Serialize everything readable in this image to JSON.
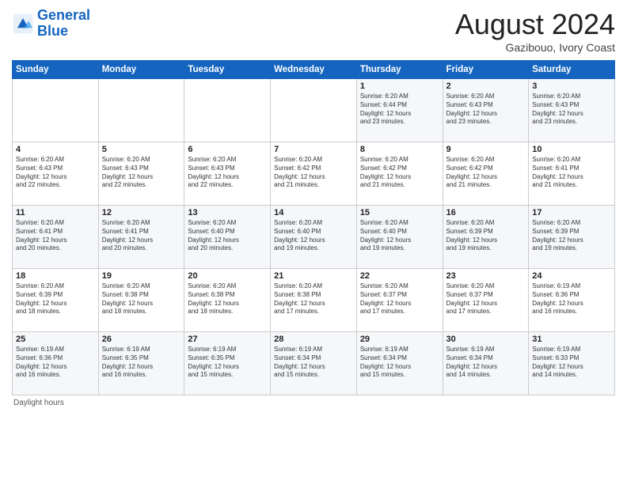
{
  "logo": {
    "line1": "General",
    "line2": "Blue"
  },
  "header": {
    "month_year": "August 2024",
    "location": "Gazibouo, Ivory Coast"
  },
  "days_of_week": [
    "Sunday",
    "Monday",
    "Tuesday",
    "Wednesday",
    "Thursday",
    "Friday",
    "Saturday"
  ],
  "weeks": [
    [
      {
        "day": "",
        "info": ""
      },
      {
        "day": "",
        "info": ""
      },
      {
        "day": "",
        "info": ""
      },
      {
        "day": "",
        "info": ""
      },
      {
        "day": "1",
        "info": "Sunrise: 6:20 AM\nSunset: 6:44 PM\nDaylight: 12 hours\nand 23 minutes."
      },
      {
        "day": "2",
        "info": "Sunrise: 6:20 AM\nSunset: 6:43 PM\nDaylight: 12 hours\nand 23 minutes."
      },
      {
        "day": "3",
        "info": "Sunrise: 6:20 AM\nSunset: 6:43 PM\nDaylight: 12 hours\nand 23 minutes."
      }
    ],
    [
      {
        "day": "4",
        "info": "Sunrise: 6:20 AM\nSunset: 6:43 PM\nDaylight: 12 hours\nand 22 minutes."
      },
      {
        "day": "5",
        "info": "Sunrise: 6:20 AM\nSunset: 6:43 PM\nDaylight: 12 hours\nand 22 minutes."
      },
      {
        "day": "6",
        "info": "Sunrise: 6:20 AM\nSunset: 6:43 PM\nDaylight: 12 hours\nand 22 minutes."
      },
      {
        "day": "7",
        "info": "Sunrise: 6:20 AM\nSunset: 6:42 PM\nDaylight: 12 hours\nand 21 minutes."
      },
      {
        "day": "8",
        "info": "Sunrise: 6:20 AM\nSunset: 6:42 PM\nDaylight: 12 hours\nand 21 minutes."
      },
      {
        "day": "9",
        "info": "Sunrise: 6:20 AM\nSunset: 6:42 PM\nDaylight: 12 hours\nand 21 minutes."
      },
      {
        "day": "10",
        "info": "Sunrise: 6:20 AM\nSunset: 6:41 PM\nDaylight: 12 hours\nand 21 minutes."
      }
    ],
    [
      {
        "day": "11",
        "info": "Sunrise: 6:20 AM\nSunset: 6:41 PM\nDaylight: 12 hours\nand 20 minutes."
      },
      {
        "day": "12",
        "info": "Sunrise: 6:20 AM\nSunset: 6:41 PM\nDaylight: 12 hours\nand 20 minutes."
      },
      {
        "day": "13",
        "info": "Sunrise: 6:20 AM\nSunset: 6:40 PM\nDaylight: 12 hours\nand 20 minutes."
      },
      {
        "day": "14",
        "info": "Sunrise: 6:20 AM\nSunset: 6:40 PM\nDaylight: 12 hours\nand 19 minutes."
      },
      {
        "day": "15",
        "info": "Sunrise: 6:20 AM\nSunset: 6:40 PM\nDaylight: 12 hours\nand 19 minutes."
      },
      {
        "day": "16",
        "info": "Sunrise: 6:20 AM\nSunset: 6:39 PM\nDaylight: 12 hours\nand 19 minutes."
      },
      {
        "day": "17",
        "info": "Sunrise: 6:20 AM\nSunset: 6:39 PM\nDaylight: 12 hours\nand 19 minutes."
      }
    ],
    [
      {
        "day": "18",
        "info": "Sunrise: 6:20 AM\nSunset: 6:39 PM\nDaylight: 12 hours\nand 18 minutes."
      },
      {
        "day": "19",
        "info": "Sunrise: 6:20 AM\nSunset: 6:38 PM\nDaylight: 12 hours\nand 18 minutes."
      },
      {
        "day": "20",
        "info": "Sunrise: 6:20 AM\nSunset: 6:38 PM\nDaylight: 12 hours\nand 18 minutes."
      },
      {
        "day": "21",
        "info": "Sunrise: 6:20 AM\nSunset: 6:38 PM\nDaylight: 12 hours\nand 17 minutes."
      },
      {
        "day": "22",
        "info": "Sunrise: 6:20 AM\nSunset: 6:37 PM\nDaylight: 12 hours\nand 17 minutes."
      },
      {
        "day": "23",
        "info": "Sunrise: 6:20 AM\nSunset: 6:37 PM\nDaylight: 12 hours\nand 17 minutes."
      },
      {
        "day": "24",
        "info": "Sunrise: 6:19 AM\nSunset: 6:36 PM\nDaylight: 12 hours\nand 16 minutes."
      }
    ],
    [
      {
        "day": "25",
        "info": "Sunrise: 6:19 AM\nSunset: 6:36 PM\nDaylight: 12 hours\nand 16 minutes."
      },
      {
        "day": "26",
        "info": "Sunrise: 6:19 AM\nSunset: 6:35 PM\nDaylight: 12 hours\nand 16 minutes."
      },
      {
        "day": "27",
        "info": "Sunrise: 6:19 AM\nSunset: 6:35 PM\nDaylight: 12 hours\nand 15 minutes."
      },
      {
        "day": "28",
        "info": "Sunrise: 6:19 AM\nSunset: 6:34 PM\nDaylight: 12 hours\nand 15 minutes."
      },
      {
        "day": "29",
        "info": "Sunrise: 6:19 AM\nSunset: 6:34 PM\nDaylight: 12 hours\nand 15 minutes."
      },
      {
        "day": "30",
        "info": "Sunrise: 6:19 AM\nSunset: 6:34 PM\nDaylight: 12 hours\nand 14 minutes."
      },
      {
        "day": "31",
        "info": "Sunrise: 6:19 AM\nSunset: 6:33 PM\nDaylight: 12 hours\nand 14 minutes."
      }
    ]
  ],
  "footer": {
    "text": "Daylight hours"
  }
}
